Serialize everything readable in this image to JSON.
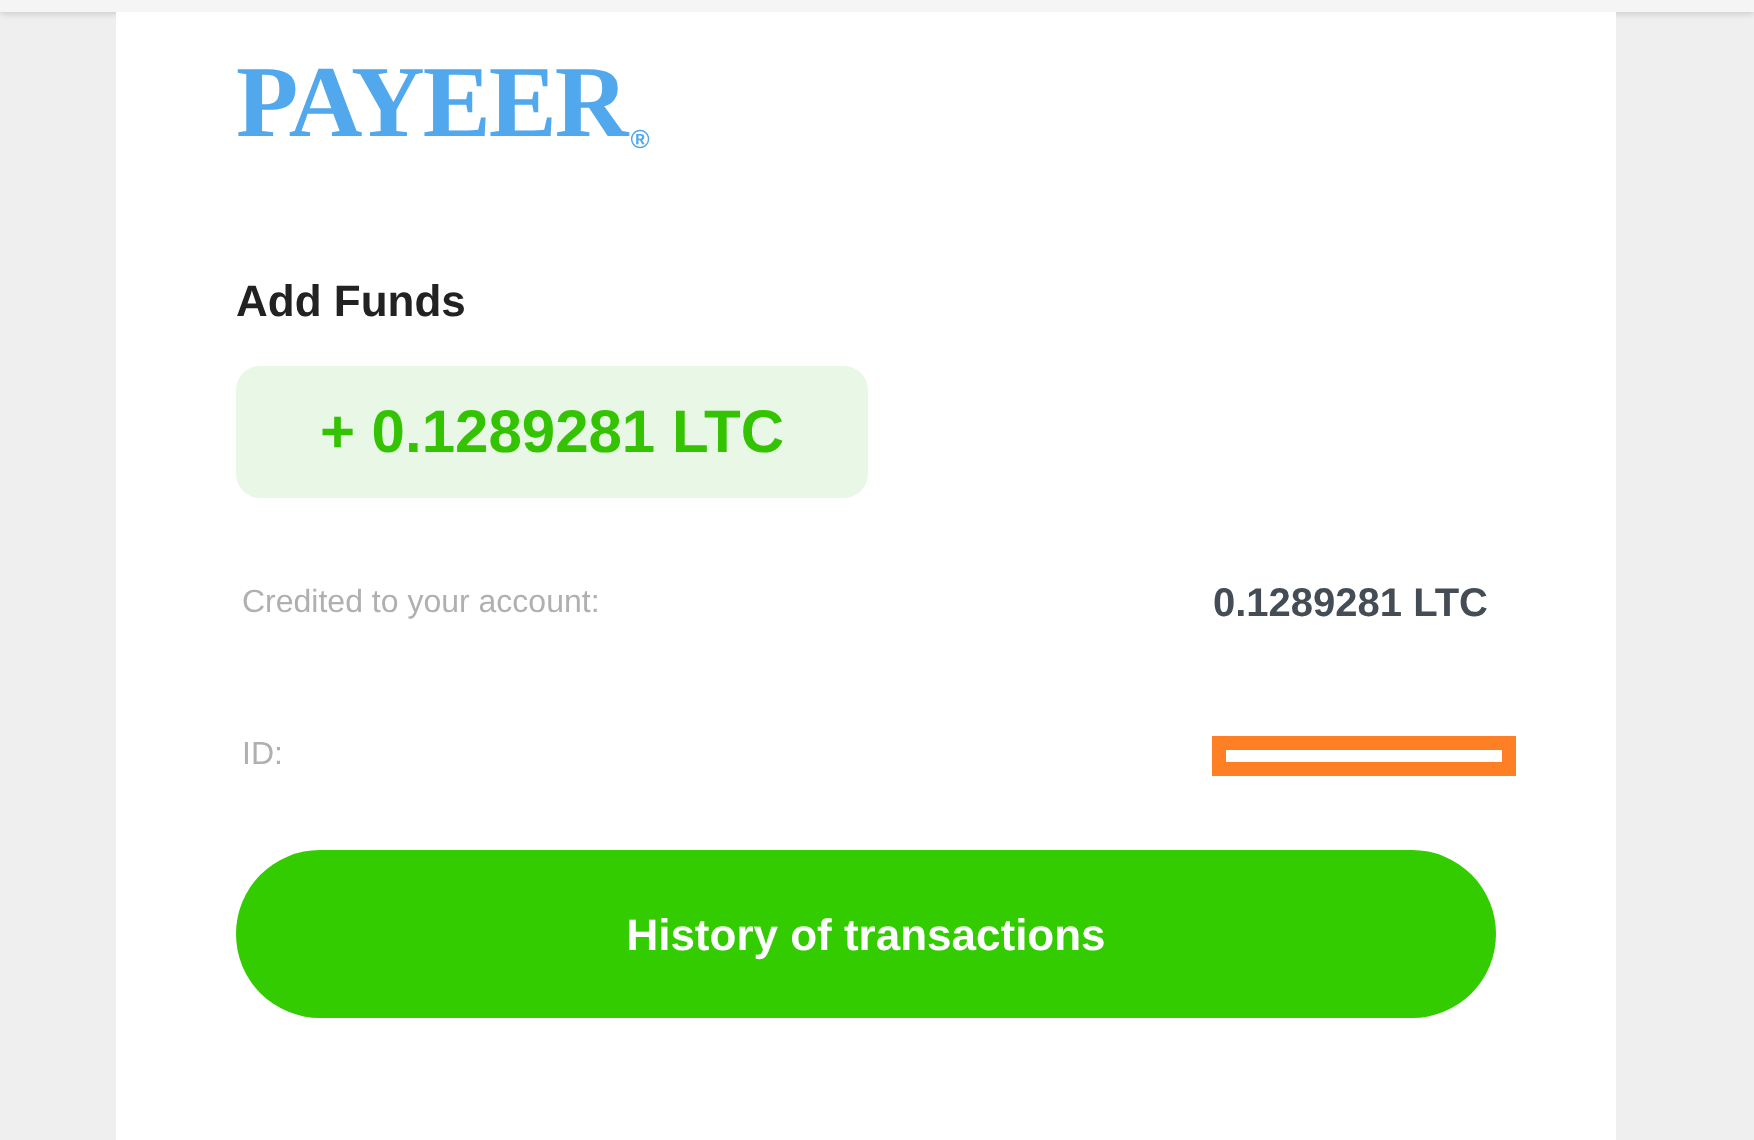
{
  "logo": {
    "text": "PAYEER",
    "mark": "®"
  },
  "heading": "Add Funds",
  "amount_badge": "+ 0.1289281 LTC",
  "details": [
    {
      "label": "Credited to your account:",
      "value": "0.1289281 LTC",
      "kind": "text"
    },
    {
      "label": "ID:",
      "kind": "redacted"
    }
  ],
  "button": "History of transactions"
}
